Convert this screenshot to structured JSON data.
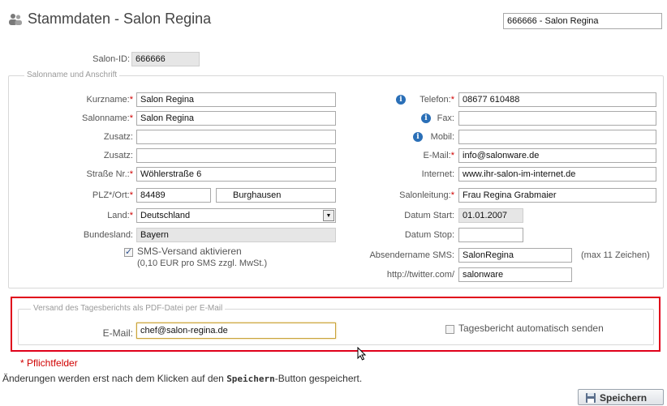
{
  "header": {
    "title": "Stammdaten - Salon Regina",
    "icon": "users-icon",
    "salon_selector_value": "666666 - Salon Regina"
  },
  "salon_id": {
    "label": "Salon-ID:",
    "value": "666666"
  },
  "address_section": {
    "legend": "Salonname und Anschrift",
    "left": {
      "kurzname": {
        "label": "Kurzname:",
        "value": "Salon Regina"
      },
      "salonname": {
        "label": "Salonname:",
        "value": "Salon Regina"
      },
      "zusatz1": {
        "label": "Zusatz:",
        "value": ""
      },
      "zusatz2": {
        "label": "Zusatz:",
        "value": ""
      },
      "strasse": {
        "label": "Straße Nr.:",
        "value": "Wöhlerstraße 6"
      },
      "plz_ort": {
        "label": "PLZ*/Ort:",
        "plz": "84489",
        "ort": "Burghausen"
      },
      "land": {
        "label": "Land:",
        "value": "Deutschland"
      },
      "bundesland": {
        "label": "Bundesland:",
        "value": "Bayern"
      },
      "sms": {
        "label": "SMS-Versand aktivieren",
        "note": "(0,10 EUR pro SMS zzgl. MwSt.)",
        "checked": true
      }
    },
    "right": {
      "telefon": {
        "label": "Telefon:",
        "value": "08677 610488"
      },
      "fax": {
        "label": "Fax:",
        "value": ""
      },
      "mobil": {
        "label": "Mobil:",
        "value": ""
      },
      "email": {
        "label": "E-Mail:",
        "value": "info@salonware.de"
      },
      "internet": {
        "label": "Internet:",
        "value": "www.ihr-salon-im-internet.de"
      },
      "salonleitung": {
        "label": "Salonleitung:",
        "value": "Frau Regina Grabmaier"
      },
      "datum_start": {
        "label": "Datum Start:",
        "value": "01.01.2007"
      },
      "datum_stop": {
        "label": "Datum Stop:",
        "value": ""
      },
      "absendername": {
        "label": "Absendername SMS:",
        "value": "SalonRegina",
        "hint": "(max 11 Zeichen)"
      },
      "twitter": {
        "label": "http://twitter.com/",
        "value": "salonware"
      }
    }
  },
  "report_section": {
    "legend": "Versand des Tagesberichts als PDF-Datei per E-Mail",
    "email_label": "E-Mail:",
    "email_value": "chef@salon-regina.de",
    "auto_send_label": "Tagesbericht automatisch senden",
    "auto_send_checked": false
  },
  "footer": {
    "required_note": "Pflichtfelder",
    "required_star": "*",
    "notice_before": "Änderungen werden erst nach dem Klicken auf den",
    "notice_bold": "Speichern",
    "notice_after": "-Button gespeichert.",
    "save_label": "Speichern"
  },
  "colors": {
    "required": "#d00000",
    "highlight": "#e0001b",
    "info": "#2a6fb7"
  }
}
